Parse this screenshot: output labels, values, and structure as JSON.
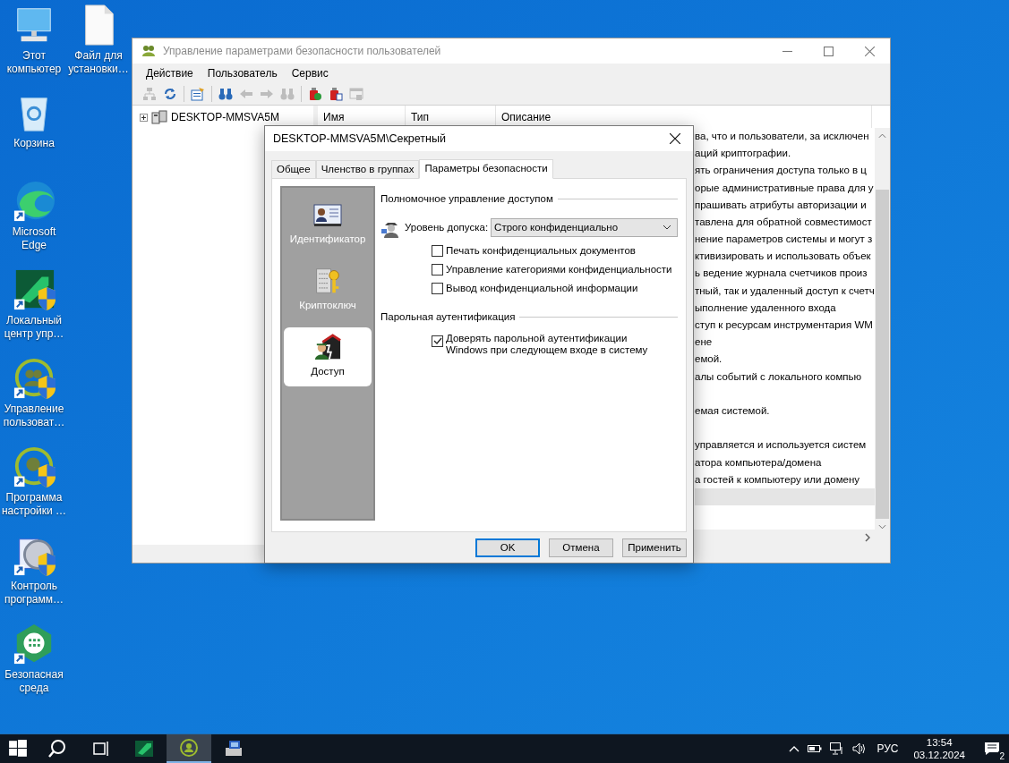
{
  "desktop_icons": [
    {
      "label": "Этот компьютер"
    },
    {
      "label": "Файл для установки…"
    },
    {
      "label": "Корзина"
    },
    {
      "label": "Microsoft Edge"
    },
    {
      "label": "Локальный центр упр…"
    },
    {
      "label": "Управление пользоват…"
    },
    {
      "label": "Программа настройки …"
    },
    {
      "label": "Контроль программ…"
    },
    {
      "label": "Безопасная среда"
    }
  ],
  "main_window": {
    "title": "Управление параметрами безопасности пользователей",
    "menu": [
      "Действие",
      "Пользователь",
      "Сервис"
    ],
    "toolbar": [
      {
        "disabled": true
      },
      {
        "disabled": false
      },
      {
        "disabled": false
      },
      {
        "disabled": false
      },
      {
        "disabled": true
      },
      {
        "disabled": true
      },
      {
        "disabled": true
      },
      {
        "disabled": false
      },
      {
        "disabled": false
      },
      {
        "disabled": true
      }
    ],
    "tree": [
      {
        "label": "DESKTOP-MMSVA5M",
        "expanded": false
      }
    ],
    "columns": [
      "Имя",
      "Тип",
      "Описание"
    ],
    "rows": [
      {
        "description": "ва, что и пользователи, за исключен",
        "selected": false
      },
      {
        "description": "аций криптографии.",
        "selected": false
      },
      {
        "description": "ять ограничения доступа только в ц",
        "selected": false
      },
      {
        "description": "орые административные права для у",
        "selected": false
      },
      {
        "description": "прашивать атрибуты авторизации и",
        "selected": false
      },
      {
        "description": "тавлена для обратной совместимост",
        "selected": false
      },
      {
        "description": "нение параметров системы и могут з",
        "selected": false
      },
      {
        "description": "ктивизировать и использовать объек",
        "selected": false
      },
      {
        "description": "ь ведение журнала счетчиков произ",
        "selected": false
      },
      {
        "description": "тный, так и удаленный доступ к счетч",
        "selected": false
      },
      {
        "description": "ыполнение удаленного входа",
        "selected": false
      },
      {
        "description": "ступ к ресурсам инструментария WM",
        "selected": false
      },
      {
        "description": "ене",
        "selected": false
      },
      {
        "description": "емой.",
        "selected": false
      },
      {
        "description": "алы событий с локального компью",
        "selected": false
      },
      {
        "selected": false
      },
      {
        "description": "емая системой.",
        "selected": false
      },
      {
        "selected": false
      },
      {
        "description": "управляется и используется систем",
        "selected": false
      },
      {
        "description": "атора компьютера/домена",
        "selected": false
      },
      {
        "description": "а гостей к компьютеру или домену",
        "selected": false
      },
      {
        "selected": true
      }
    ]
  },
  "dialog": {
    "title": "DESKTOP-MMSVA5M\\Секретный",
    "tabs": [
      {
        "label": "Общее",
        "selected": false
      },
      {
        "label": "Членство в группах",
        "selected": false
      },
      {
        "label": "Параметры безопасности",
        "selected": true
      }
    ],
    "side_nav": [
      {
        "label": "Идентификатор",
        "selected": false
      },
      {
        "label": "Криптоключ",
        "selected": false
      },
      {
        "label": "Доступ",
        "selected": true
      }
    ],
    "access_section": {
      "title": "Полномочное управление доступом",
      "level_label": "Уровень допуска:",
      "level_value": "Строго конфиденциально",
      "options": [
        {
          "label": "Печать конфиденциальных документов",
          "checked": false
        },
        {
          "label": "Управление категориями конфиденциальности",
          "checked": false
        },
        {
          "label": "Вывод конфиденциальной информации",
          "checked": false
        }
      ]
    },
    "password_section": {
      "title": "Парольная аутентификация",
      "options": [
        {
          "label": "Доверять парольной аутентификации Windows при следующем входе в систему",
          "checked": true
        }
      ]
    },
    "buttons": [
      {
        "label": "OK",
        "default": true
      },
      {
        "label": "Отмена",
        "default": false
      },
      {
        "label": "Применить",
        "default": false
      }
    ]
  },
  "taskbar": {
    "apps": [
      {
        "active": false
      },
      {
        "active": true
      },
      {
        "active": false
      }
    ],
    "language": "РУС",
    "time": "13:54",
    "date": "03.12.2024",
    "notifications": "2"
  }
}
